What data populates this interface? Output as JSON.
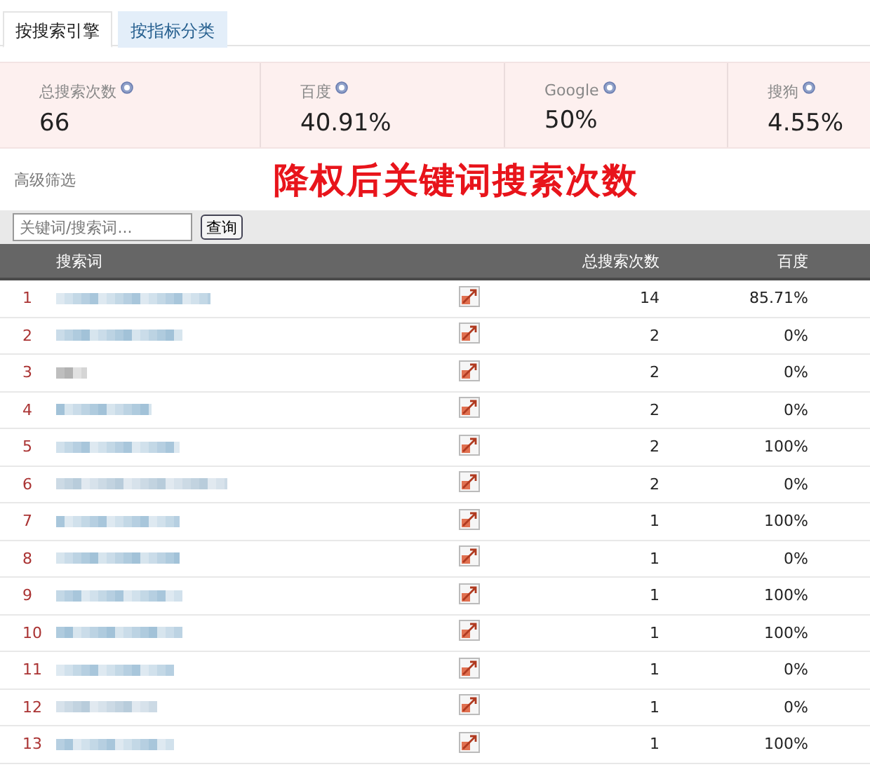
{
  "tabs": [
    {
      "label": "按搜索引擎",
      "selected": true
    },
    {
      "label": "按指标分类",
      "selected": false
    }
  ],
  "stats": [
    {
      "label": "总搜索次数",
      "value": "66"
    },
    {
      "label": "百度",
      "value": "40.91%"
    },
    {
      "label": "Google",
      "value": "50%"
    },
    {
      "label": "搜狗",
      "value": "4.55%"
    }
  ],
  "advanced_filter": "高级筛选",
  "overlay_title": "降权后关键词搜索次数",
  "search": {
    "placeholder": "关键词/搜索词...",
    "button": "查询"
  },
  "table": {
    "columns": [
      "搜索词",
      "总搜索次数",
      "百度"
    ],
    "rows": [
      {
        "rank": "1",
        "count": "14",
        "baidu": "85.71%"
      },
      {
        "rank": "2",
        "count": "2",
        "baidu": "0%"
      },
      {
        "rank": "3",
        "count": "2",
        "baidu": "0%"
      },
      {
        "rank": "4",
        "count": "2",
        "baidu": "0%"
      },
      {
        "rank": "5",
        "count": "2",
        "baidu": "100%"
      },
      {
        "rank": "6",
        "count": "2",
        "baidu": "0%"
      },
      {
        "rank": "7",
        "count": "1",
        "baidu": "100%"
      },
      {
        "rank": "8",
        "count": "1",
        "baidu": "0%"
      },
      {
        "rank": "9",
        "count": "1",
        "baidu": "100%"
      },
      {
        "rank": "10",
        "count": "1",
        "baidu": "100%"
      },
      {
        "rank": "11",
        "count": "1",
        "baidu": "0%"
      },
      {
        "rank": "12",
        "count": "1",
        "baidu": "0%"
      },
      {
        "rank": "13",
        "count": "1",
        "baidu": "100%"
      }
    ]
  }
}
